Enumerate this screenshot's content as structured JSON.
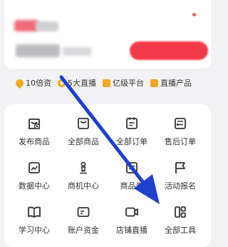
{
  "features": [
    {
      "label": "10倍资",
      "icon": "drop-icon"
    },
    {
      "label": "5大直播",
      "icon": "medal-icon"
    },
    {
      "label": "亿级平台",
      "icon": "ticket-icon"
    },
    {
      "label": "直播产品",
      "icon": "box-icon"
    }
  ],
  "tools": [
    {
      "label": "发布商品",
      "icon": "publish-product-icon"
    },
    {
      "label": "全部商品",
      "icon": "all-products-icon"
    },
    {
      "label": "全部订单",
      "icon": "all-orders-icon"
    },
    {
      "label": "售后订单",
      "icon": "after-sales-icon"
    },
    {
      "label": "数据中心",
      "icon": "data-center-icon"
    },
    {
      "label": "商机中心",
      "icon": "opportunity-icon"
    },
    {
      "label": "商品卷",
      "icon": "product-coupon-icon"
    },
    {
      "label": "活动报名",
      "icon": "event-signup-icon"
    },
    {
      "label": "学习中心",
      "icon": "learning-icon"
    },
    {
      "label": "账户资金",
      "icon": "account-funds-icon"
    },
    {
      "label": "店铺直播",
      "icon": "store-live-icon"
    },
    {
      "label": "全部工具",
      "icon": "all-tools-icon"
    }
  ],
  "colors": {
    "accent": "#f23b4a",
    "feature_icon": "#f5a623",
    "arrow": "#1f3fd1"
  }
}
